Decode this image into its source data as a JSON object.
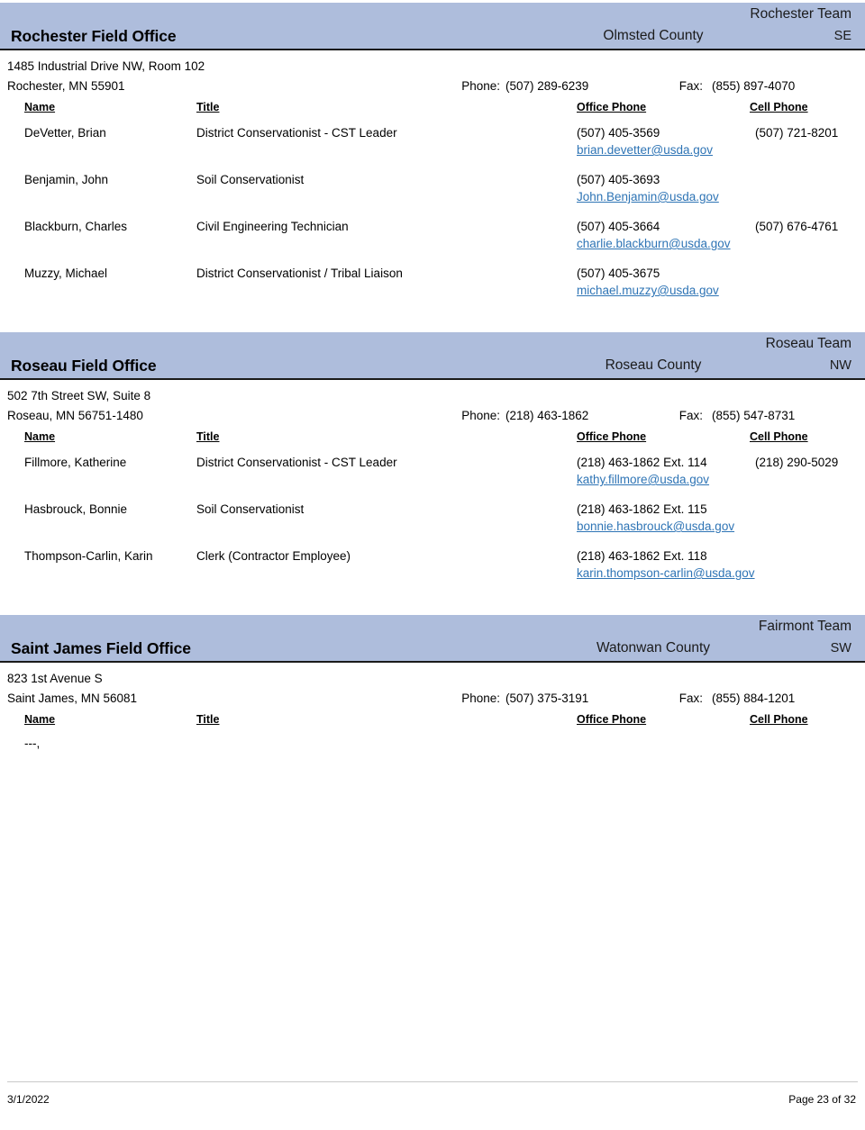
{
  "document": {
    "columns": {
      "name": "Name",
      "title": "Title",
      "office_phone": "Office Phone",
      "cell_phone": "Cell Phone"
    },
    "labels": {
      "phone": "Phone:",
      "fax": "Fax:"
    },
    "colors": {
      "band_background": "#aebddc",
      "band_border": "#1a1a1a",
      "link": "#2e74b5",
      "page_background": "#ffffff",
      "text": "#000000"
    }
  },
  "offices": [
    {
      "name": "Rochester Field Office",
      "team": "Rochester Team",
      "county": "Olmsted County",
      "region": "SE",
      "address_line1": "1485 Industrial Drive NW, Room 102",
      "address_line2": "Rochester, MN  55901",
      "phone": "(507) 289-6239",
      "fax": "(855) 897-4070",
      "staff": [
        {
          "name": "DeVetter, Brian",
          "title": "District Conservationist - CST Leader",
          "office_phone": "(507) 405-3569",
          "cell_phone": "(507) 721-8201",
          "email": "brian.devetter@usda.gov"
        },
        {
          "name": "Benjamin, John",
          "title": "Soil Conservationist",
          "office_phone": "(507) 405-3693",
          "cell_phone": "",
          "email": "John.Benjamin@usda.gov"
        },
        {
          "name": "Blackburn, Charles",
          "title": "Civil Engineering Technician",
          "office_phone": "(507) 405-3664",
          "cell_phone": "(507) 676-4761",
          "email": "charlie.blackburn@usda.gov"
        },
        {
          "name": "Muzzy, Michael",
          "title": "District Conservationist / Tribal Liaison",
          "office_phone": "(507) 405-3675",
          "cell_phone": "",
          "email": "michael.muzzy@usda.gov"
        }
      ]
    },
    {
      "name": "Roseau Field Office",
      "team": "Roseau Team",
      "county": "Roseau County",
      "region": "NW",
      "address_line1": "502 7th Street SW, Suite 8",
      "address_line2": "Roseau, MN  56751-1480",
      "phone": "(218) 463-1862",
      "fax": "(855) 547-8731",
      "staff": [
        {
          "name": "Fillmore, Katherine",
          "title": "District Conservationist - CST Leader",
          "office_phone": "(218) 463-1862  Ext. 114",
          "cell_phone": "(218) 290-5029",
          "email": "kathy.fillmore@usda.gov"
        },
        {
          "name": "Hasbrouck, Bonnie",
          "title": "Soil Conservationist",
          "office_phone": "(218) 463-1862  Ext. 115",
          "cell_phone": "",
          "email": "bonnie.hasbrouck@usda.gov"
        },
        {
          "name": "Thompson-Carlin, Karin",
          "title": "Clerk (Contractor Employee)",
          "office_phone": "(218) 463-1862  Ext. 118",
          "cell_phone": "",
          "email": "karin.thompson-carlin@usda.gov"
        }
      ]
    },
    {
      "name": "Saint James Field Office",
      "team": "Fairmont Team",
      "county": "Watonwan County",
      "region": "SW",
      "address_line1": "823 1st Avenue S",
      "address_line2": "Saint James, MN  56081",
      "phone": "(507) 375-3191",
      "fax": "(855) 884-1201",
      "staff": [
        {
          "name": "---,",
          "title": "",
          "office_phone": "",
          "cell_phone": "",
          "email": ""
        }
      ]
    }
  ],
  "footer": {
    "date": "3/1/2022",
    "page": "Page 23 of 32"
  }
}
